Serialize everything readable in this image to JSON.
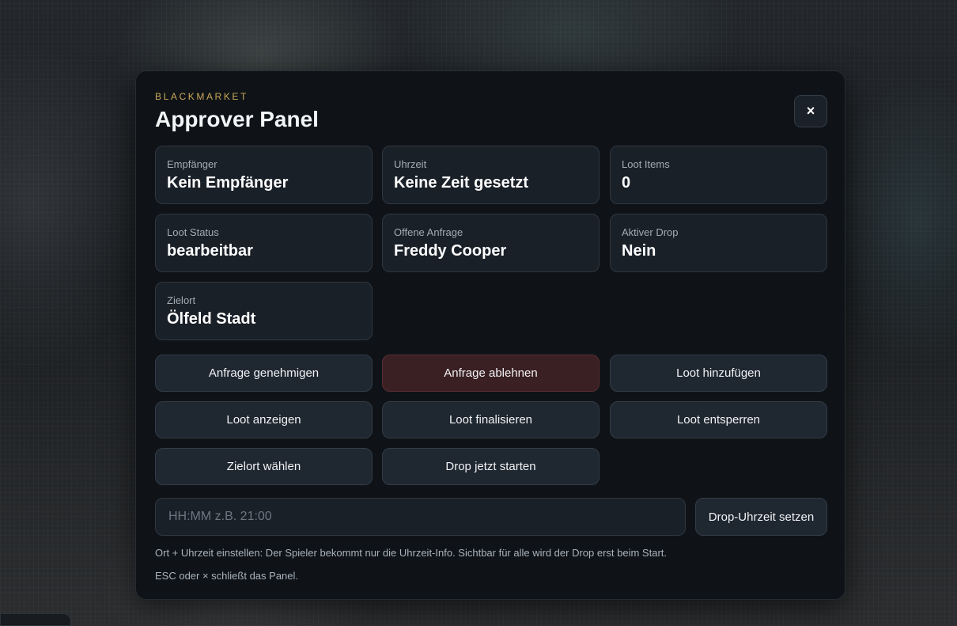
{
  "header": {
    "eyebrow": "BLACKMARKET",
    "title": "Approver Panel",
    "close_label": "×"
  },
  "info": [
    {
      "label": "Empfänger",
      "value": "Kein Empfänger"
    },
    {
      "label": "Uhrzeit",
      "value": "Keine Zeit gesetzt"
    },
    {
      "label": "Loot Items",
      "value": "0"
    },
    {
      "label": "Loot Status",
      "value": "bearbeitbar"
    },
    {
      "label": "Offene Anfrage",
      "value": "Freddy Cooper"
    },
    {
      "label": "Aktiver Drop",
      "value": "Nein"
    },
    {
      "label": "Zielort",
      "value": "Ölfeld Stadt"
    }
  ],
  "actions": [
    "Anfrage genehmigen",
    "Anfrage ablehnen",
    "Loot hinzufügen",
    "Loot anzeigen",
    "Loot finalisieren",
    "Loot entsperren",
    "Zielort wählen",
    "Drop jetzt starten"
  ],
  "time_input": {
    "value": "",
    "placeholder": "HH:MM z.B. 21:00",
    "submit_label": "Drop-Uhrzeit setzen"
  },
  "hints": [
    "Ort + Uhrzeit einstellen: Der Spieler bekommt nur die Uhrzeit-Info. Sichtbar für alle wird der Drop erst beim Start.",
    "ESC oder × schließt das Panel."
  ],
  "colors": {
    "accent": "#c9a85a",
    "danger": "#3a1f23"
  }
}
